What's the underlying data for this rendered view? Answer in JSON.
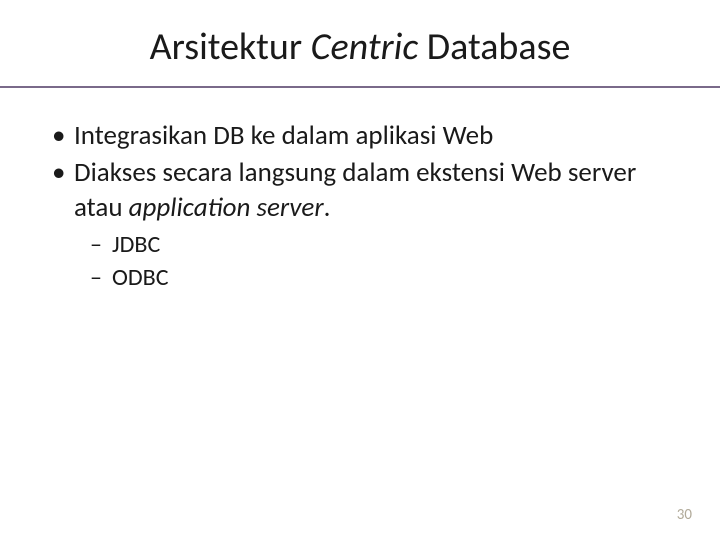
{
  "title": {
    "part1": "Arsitektur ",
    "italic": "Centric",
    "part2": " Database"
  },
  "bullets": [
    {
      "text": "Integrasikan DB ke dalam aplikasi Web"
    },
    {
      "prefix": "Diakses secara langsung dalam ekstensi Web server atau ",
      "italic": "application server",
      "suffix": "."
    }
  ],
  "sub_bullets": [
    "JDBC",
    "ODBC"
  ],
  "page_number": "30"
}
